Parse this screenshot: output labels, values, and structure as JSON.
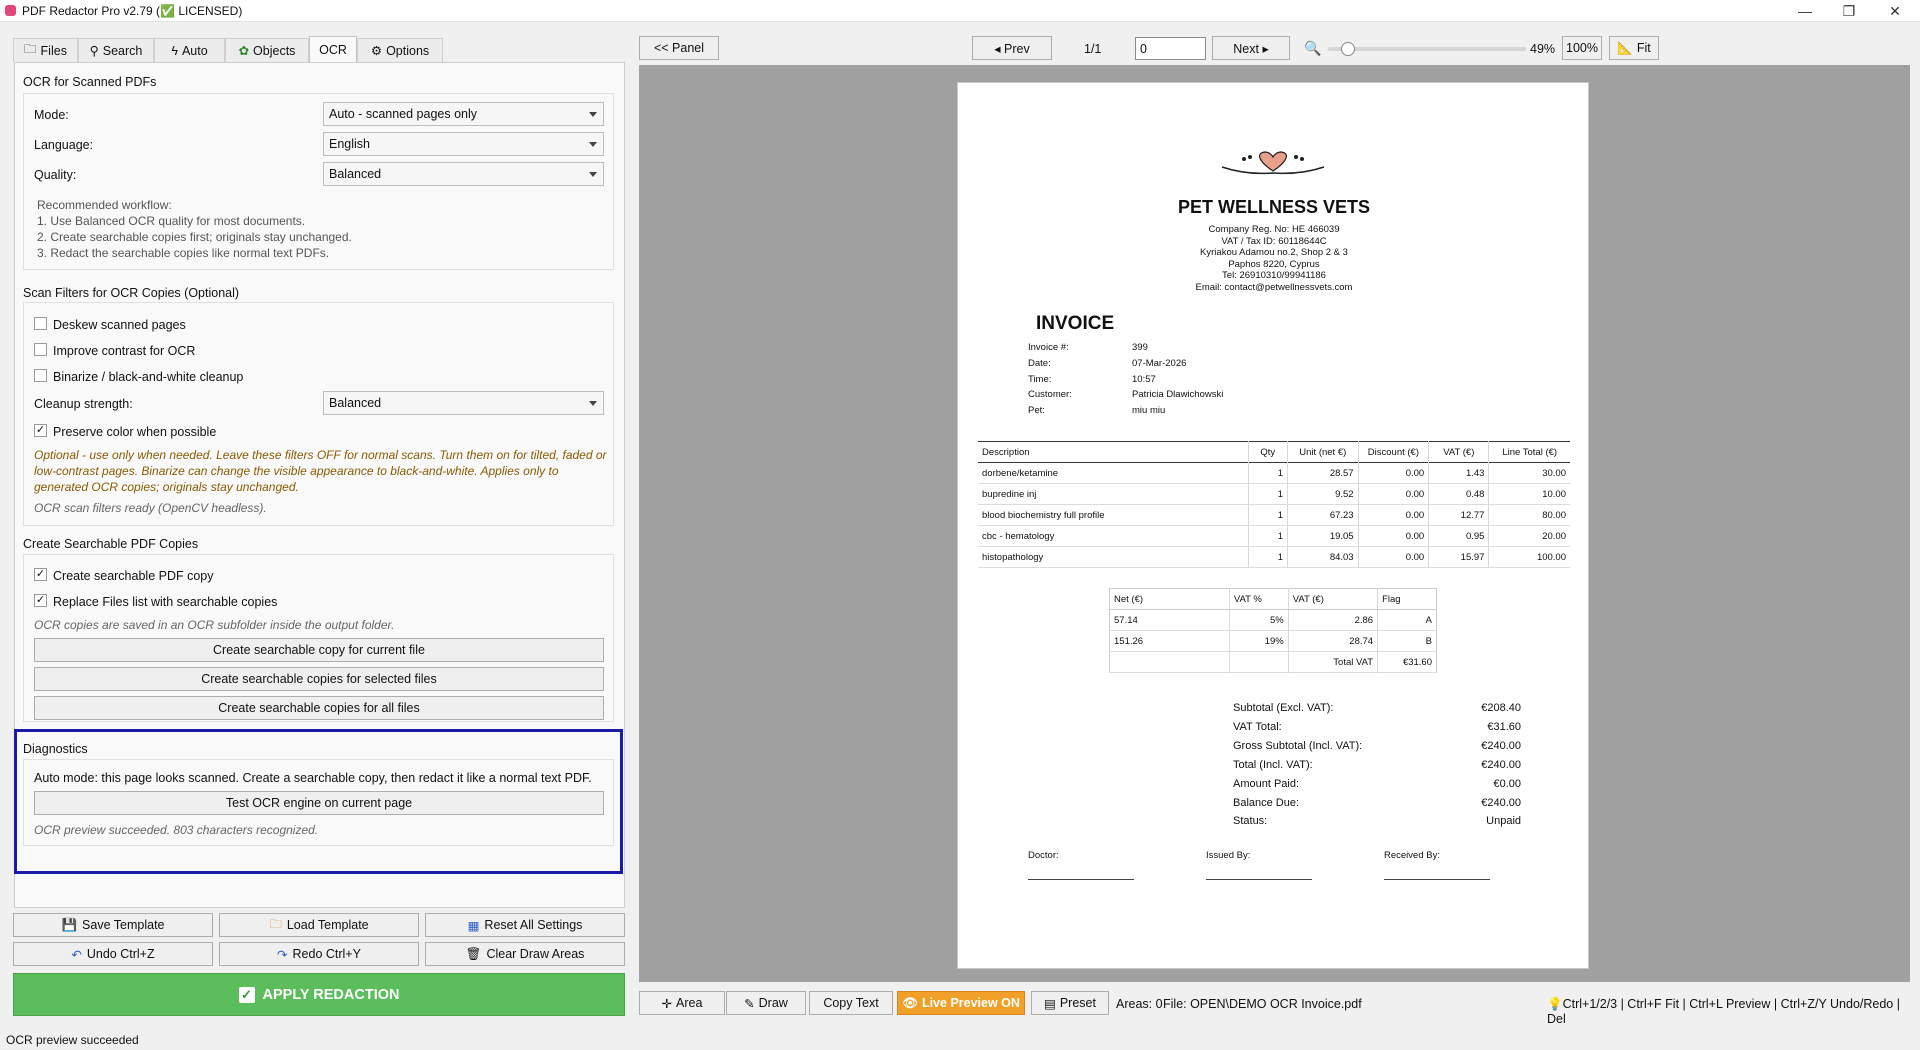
{
  "window": {
    "title": "PDF Redactor Pro v2.79 (✅ LICENSED)",
    "min": "—",
    "max": "❐",
    "close": "✕"
  },
  "tabs": [
    "Files",
    "Search",
    "Auto",
    "Objects",
    "OCR",
    "Options"
  ],
  "ocr_section": {
    "title": "OCR for Scanned PDFs",
    "mode_label": "Mode:",
    "mode_value": "Auto - scanned pages only",
    "language_label": "Language:",
    "language_value": "English",
    "quality_label": "Quality:",
    "quality_value": "Balanced",
    "workflow": [
      "Recommended workflow:",
      "1. Use Balanced OCR quality for most documents.",
      "2. Create searchable copies first; originals stay unchanged.",
      "3. Redact the searchable copies like normal text PDFs."
    ]
  },
  "scan_filters": {
    "title": "Scan Filters for OCR Copies (Optional)",
    "deskew": "Deskew scanned pages",
    "contrast": "Improve contrast for OCR",
    "binarize": "Binarize / black-and-white cleanup",
    "cleanup_label": "Cleanup strength:",
    "cleanup_value": "Balanced",
    "preserve": "Preserve color when possible",
    "check_mark": "✓",
    "warning": [
      "Optional - use only when needed. Leave these filters OFF for normal scans. Turn them on for tilted, faded or",
      "low-contrast pages. Binarize can change the visible appearance to black-and-white. Applies only to",
      "generated OCR copies; originals stay unchanged."
    ],
    "ready": "OCR scan filters ready (OpenCV headless)."
  },
  "searchable": {
    "title": "Create Searchable PDF Copies",
    "create_copy": "Create searchable PDF copy",
    "replace_list": "Replace Files list with searchable copies",
    "note": "OCR copies are saved in an OCR subfolder inside the output folder.",
    "btn_current": "Create searchable copy for current file",
    "btn_selected": "Create searchable copies for selected files",
    "btn_all": "Create searchable copies for all files"
  },
  "diagnostics": {
    "title": "Diagnostics",
    "message": "Auto mode: this page looks scanned. Create a searchable copy, then redact it like a normal text PDF.",
    "test_button": "Test OCR engine on current page",
    "result": "OCR preview succeeded. 803 characters recognized."
  },
  "bottom_buttons": {
    "save_template": "Save Template",
    "load_template": "Load Template",
    "reset": "Reset All Settings",
    "undo": "Undo  Ctrl+Z",
    "redo": "Redo  Ctrl+Y",
    "clear": "Clear Draw Areas",
    "apply": "APPLY REDACTION"
  },
  "status": "OCR preview succeeded",
  "toolbar": {
    "panel": "<< Panel",
    "prev": "◂ Prev",
    "page_count": "1/1",
    "page_input": "0",
    "next": "Next ▸",
    "zoom_percent": "49%",
    "zoom_level": 0.1,
    "hundred": "100%",
    "fit": "Fit"
  },
  "bottom_toolbar": {
    "area": "Area",
    "draw": "Draw",
    "copy_text": "Copy Text",
    "live_preview": "Live Preview ON",
    "preset": "Preset",
    "areas": "Areas: 0",
    "file": "File: OPEN\\DEMO OCR Invoice.pdf",
    "shortcuts": "Ctrl+1/2/3 | Ctrl+F Fit | Ctrl+L Preview | Ctrl+Z/Y Undo/Redo | Del"
  },
  "invoice": {
    "clinic": "PET WELLNESS VETS",
    "address": [
      "Company Reg. No: HE 466039",
      "VAT / Tax ID: 60118644C",
      "Kyriakou Adamou no.2, Shop 2 & 3",
      "Paphos 8220, Cyprus",
      "Tel: 26910310/99941186",
      "Email: contact@petwellnessvets.com"
    ],
    "heading": "INVOICE",
    "meta": [
      {
        "k": "Invoice #:",
        "v": "399"
      },
      {
        "k": "Date:",
        "v": "07-Mar-2026"
      },
      {
        "k": "Time:",
        "v": "10:57"
      },
      {
        "k": "Customer:",
        "v": "Patricia Dlawichowski"
      },
      {
        "k": "Pet:",
        "v": "miu miu"
      }
    ],
    "columns": [
      "Description",
      "Qty",
      "Unit (net €)",
      "Discount (€)",
      "VAT (€)",
      "Line Total (€)"
    ],
    "rows": [
      [
        "dorbene/ketamine",
        "1",
        "28.57",
        "0.00",
        "1.43",
        "30.00"
      ],
      [
        "bupredine inj",
        "1",
        "9.52",
        "0.00",
        "0.48",
        "10.00"
      ],
      [
        "blood biochemistry full profile",
        "1",
        "67.23",
        "0.00",
        "12.77",
        "80.00"
      ],
      [
        "cbc - hematology",
        "1",
        "19.05",
        "0.00",
        "0.95",
        "20.00"
      ],
      [
        "histopathology",
        "1",
        "84.03",
        "0.00",
        "15.97",
        "100.00"
      ]
    ],
    "vat_columns": [
      "Net (€)",
      "VAT %",
      "VAT (€)",
      "Flag"
    ],
    "vat_rows": [
      [
        "57.14",
        "5%",
        "2.86",
        "A"
      ],
      [
        "151.26",
        "19%",
        "28.74",
        "B"
      ],
      [
        "",
        "",
        "Total VAT",
        "€31.60"
      ]
    ],
    "totals": [
      {
        "k": "Subtotal (Excl. VAT):",
        "v": "€208.40"
      },
      {
        "k": "VAT Total:",
        "v": "€31.60"
      },
      {
        "k": "Gross Subtotal (Incl. VAT):",
        "v": "€240.00"
      },
      {
        "k": "Total (Incl. VAT):",
        "v": "€240.00"
      },
      {
        "k": "Amount Paid:",
        "v": "€0.00"
      },
      {
        "k": "Balance Due:",
        "v": "€240.00"
      },
      {
        "k": "Status:",
        "v": "Unpaid"
      }
    ],
    "signatures": [
      "Doctor:",
      "Issued By:",
      "Received By:"
    ]
  }
}
